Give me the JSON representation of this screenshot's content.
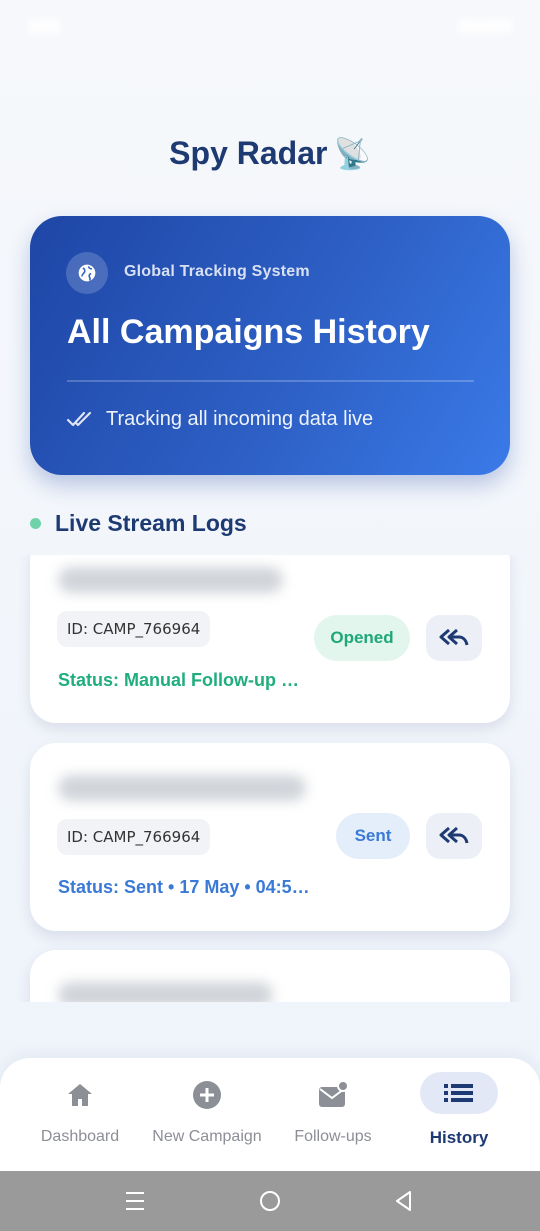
{
  "app": {
    "title": "Spy Radar",
    "title_emoji": "📡"
  },
  "hero": {
    "subtitle": "Global Tracking System",
    "heading": "All Campaigns History",
    "live_text": "Tracking all incoming data live",
    "icon": "globe-icon",
    "colors": {
      "start": "#1e46a6",
      "end": "#3a7ae8"
    }
  },
  "section": {
    "label": "Live Stream Logs"
  },
  "logs": [
    {
      "id": "ID: CAMP_766964",
      "badge": "Opened",
      "status": "Status: Manual Follow-up …"
    },
    {
      "id": "ID: CAMP_766964",
      "badge": "Sent",
      "status": "Status: Sent • 17 May • 04:5…"
    }
  ],
  "nav": [
    {
      "label": "Dashboard",
      "icon": "home-icon"
    },
    {
      "label": "New Campaign",
      "icon": "plus-circle-icon"
    },
    {
      "label": "Follow-ups",
      "icon": "mail-icon"
    },
    {
      "label": "History",
      "icon": "list-icon",
      "active": true
    }
  ],
  "colors": {
    "accent": "#1e3a72",
    "opened": "#1fae7c",
    "sent": "#3a7ad6"
  }
}
